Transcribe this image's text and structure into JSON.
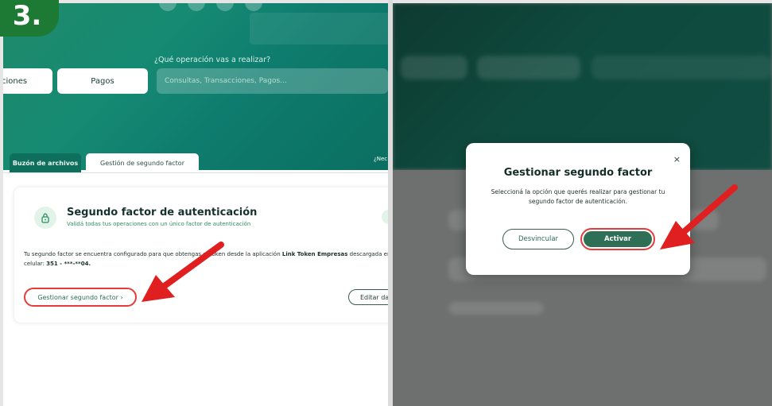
{
  "step_badge": "3.",
  "left": {
    "hero": {
      "question": "¿Qué operación vas a realizar?",
      "pills": [
        "ciones",
        "Pagos"
      ],
      "search_placeholder": "Consultas, Transacciones, Pagos...",
      "help_text": "¿Nec"
    },
    "tabs": [
      {
        "label": "Buzón de archivos",
        "active": false
      },
      {
        "label": "Gestión de segundo factor",
        "active": true
      }
    ],
    "card": {
      "title": "Segundo factor de autenticación",
      "subtitle": "Validá todas tus operaciones con un único factor de autenticación",
      "text_part1": "Tu segundo factor se encuentra configurado para que obtengas el token desde la aplicación ",
      "app_name": "Link Token Empresas",
      "text_part2": " descargada en tu celular: ",
      "phone": "351 - ***-**04.",
      "primary_button": "Gestionar segundo factor  ›",
      "secondary_button": "Editar dat"
    }
  },
  "right": {
    "modal": {
      "close_symbol": "×",
      "title": "Gestionar segundo factor",
      "text": "Seleccioná la opción que querés realizar para gestionar tu segundo factor de autenticación.",
      "button_unlink": "Desvincular",
      "button_activate": "Activar"
    }
  },
  "colors": {
    "brand_green": "#0e7c6e",
    "badge_green": "#1d7a34",
    "highlight_red": "#e53b3b",
    "button_green": "#2f6f56"
  }
}
